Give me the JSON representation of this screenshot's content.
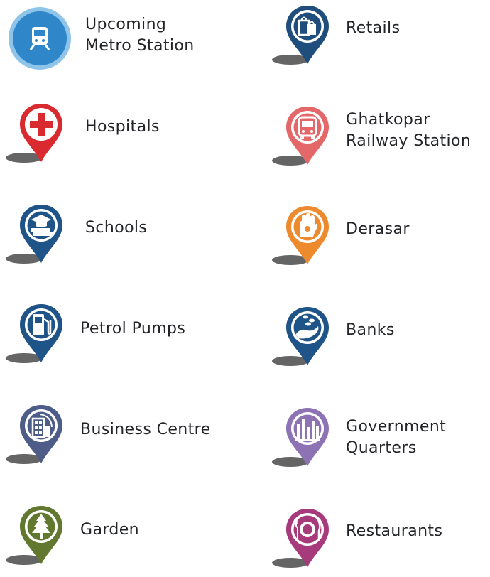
{
  "legend": {
    "items": [
      {
        "id": "metro",
        "label_lines": [
          "Upcoming",
          "Metro Station"
        ],
        "icon": "train-icon",
        "color": "#2f86c8",
        "style": "circle"
      },
      {
        "id": "retail",
        "label_lines": [
          "Retails"
        ],
        "icon": "shopping-bags-icon",
        "color": "#1f4e7c",
        "style": "pin"
      },
      {
        "id": "hospital",
        "label_lines": [
          "Hospitals"
        ],
        "icon": "medical-cross-icon",
        "color": "#d92a2f",
        "style": "pin"
      },
      {
        "id": "railway",
        "label_lines": [
          "Ghatkopar",
          "Railway Station"
        ],
        "icon": "bus-icon",
        "color": "#e4676a",
        "style": "pin"
      },
      {
        "id": "school",
        "label_lines": [
          "Schools"
        ],
        "icon": "graduation-books-icon",
        "color": "#1f5488",
        "style": "pin"
      },
      {
        "id": "derasar",
        "label_lines": [
          "Derasar"
        ],
        "icon": "jain-hand-icon",
        "color": "#ee8a2e",
        "style": "pin"
      },
      {
        "id": "petrol",
        "label_lines": [
          "Petrol Pumps"
        ],
        "icon": "fuel-pump-icon",
        "color": "#1f5488",
        "style": "pin"
      },
      {
        "id": "bank",
        "label_lines": [
          "Banks"
        ],
        "icon": "coins-hand-icon",
        "color": "#1f5488",
        "style": "pin"
      },
      {
        "id": "business",
        "label_lines": [
          "Business Centre"
        ],
        "icon": "office-building-icon",
        "color": "#4d5d87",
        "style": "pin"
      },
      {
        "id": "government",
        "label_lines": [
          "Government",
          "Quarters"
        ],
        "icon": "city-skyline-icon",
        "color": "#8d73b4",
        "style": "pin"
      },
      {
        "id": "garden",
        "label_lines": [
          "Garden"
        ],
        "icon": "tree-icon",
        "color": "#62782f",
        "style": "pin"
      },
      {
        "id": "restaurant",
        "label_lines": [
          "Restaurants"
        ],
        "icon": "plate-cutlery-icon",
        "color": "#a63a7a",
        "style": "pin"
      }
    ]
  },
  "shadow_color": "#4a4a4a"
}
